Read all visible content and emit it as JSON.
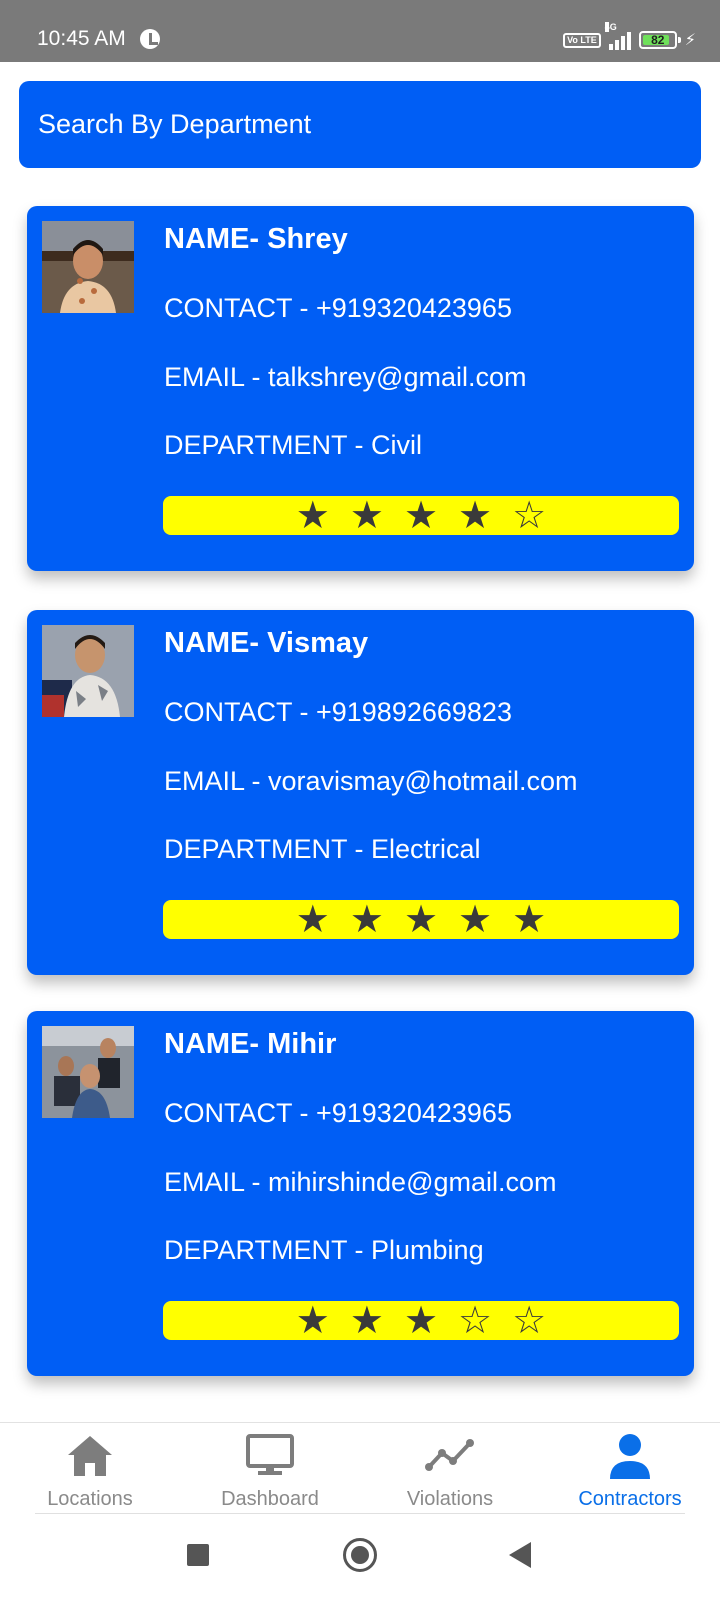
{
  "status_bar": {
    "time": "10:45 AM",
    "network": "4G",
    "volte": "Vo LTE",
    "battery": "82"
  },
  "search": {
    "label": "Search By Department"
  },
  "contractors": [
    {
      "name": "NAME- Shrey",
      "contact": "CONTACT - +919320423965",
      "email": "EMAIL - talkshrey@gmail.com",
      "department": "DEPARTMENT - Civil",
      "rating": 4,
      "rating_max": 5
    },
    {
      "name": "NAME- Vismay",
      "contact": "CONTACT - +919892669823",
      "email": "EMAIL - voravismay@hotmail.com",
      "department": "DEPARTMENT - Electrical",
      "rating": 5,
      "rating_max": 5
    },
    {
      "name": "NAME- Mihir",
      "contact": "CONTACT - +919320423965",
      "email": "EMAIL - mihirshinde@gmail.com",
      "department": "DEPARTMENT - Plumbing",
      "rating": 3,
      "rating_max": 5
    }
  ],
  "bottom_nav": {
    "items": [
      {
        "label": "Locations",
        "icon": "home-icon"
      },
      {
        "label": "Dashboard",
        "icon": "monitor-icon"
      },
      {
        "label": "Violations",
        "icon": "trend-line-icon"
      },
      {
        "label": "Contractors",
        "icon": "person-icon",
        "active": true
      }
    ]
  },
  "colors": {
    "primary": "#005ef5",
    "rating_bg": "#ffff00",
    "star": "#3a3a3a",
    "nav_active": "#0a6fe8",
    "nav_inactive": "#8a8a8a"
  }
}
